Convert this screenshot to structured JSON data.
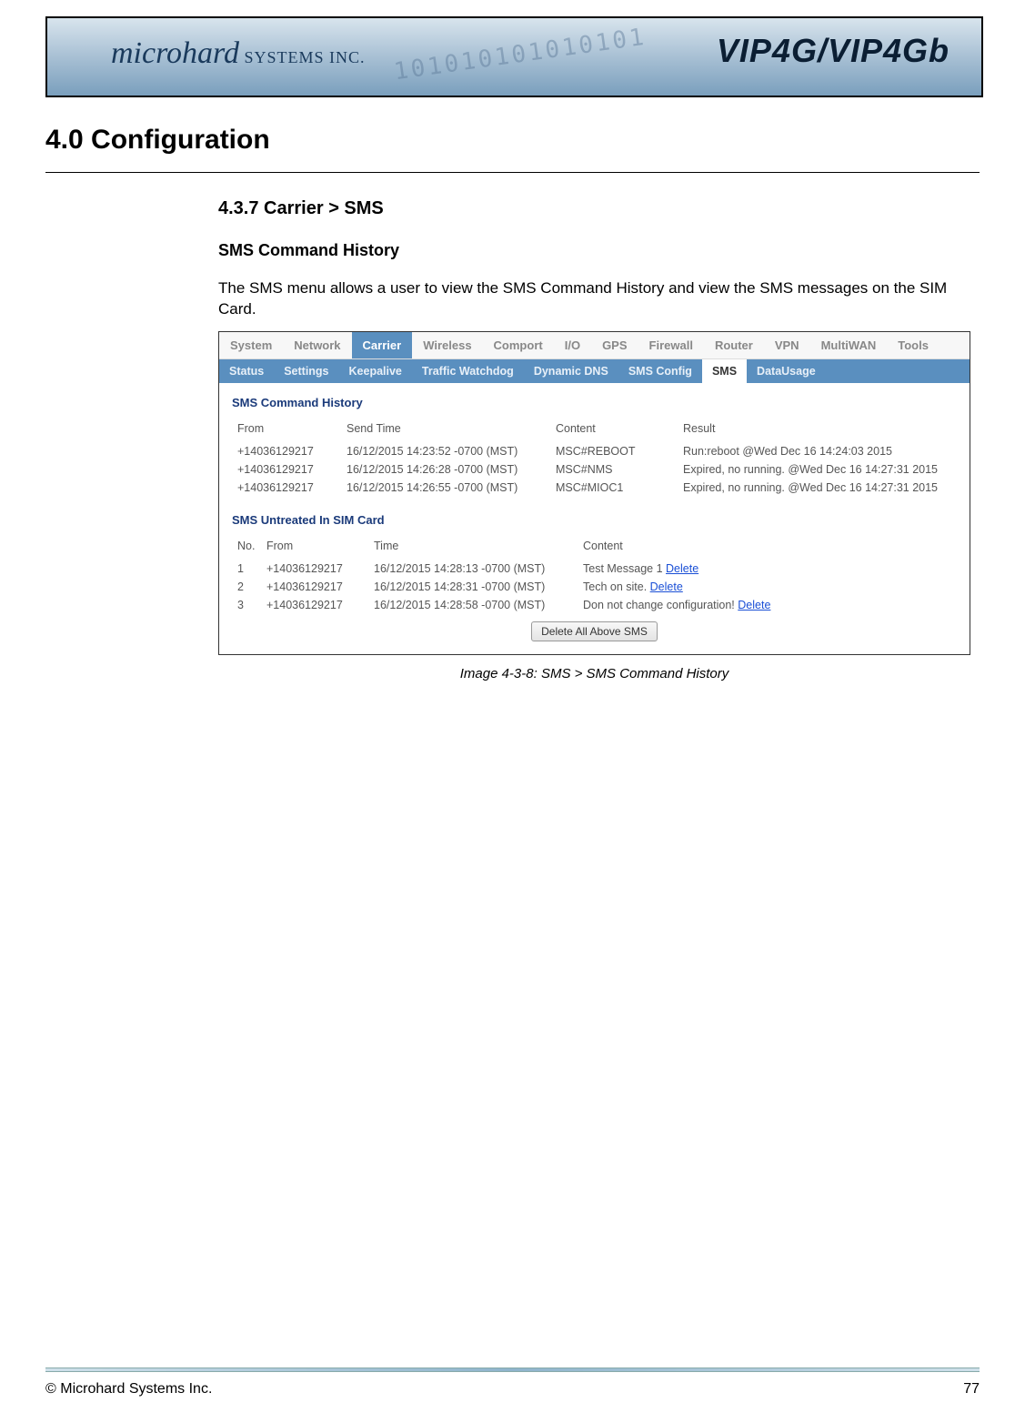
{
  "banner": {
    "company_italic": "microhard",
    "company_caps": " SYSTEMS INC.",
    "product": "VIP4G/VIP4Gb",
    "digits": "101010101010101"
  },
  "section_title": "4.0  Configuration",
  "subsection": "4.3.7 Carrier > SMS",
  "subsub": "SMS Command History",
  "body_text": "The SMS menu allows a user to view the SMS Command History and view the SMS messages on the SIM Card.",
  "toptabs": [
    "System",
    "Network",
    "Carrier",
    "Wireless",
    "Comport",
    "I/O",
    "GPS",
    "Firewall",
    "Router",
    "VPN",
    "MultiWAN",
    "Tools"
  ],
  "toptabs_active": 2,
  "subtabs": [
    "Status",
    "Settings",
    "Keepalive",
    "Traffic Watchdog",
    "Dynamic DNS",
    "SMS Config",
    "SMS",
    "DataUsage"
  ],
  "subtabs_active": 6,
  "history": {
    "title": "SMS Command History",
    "headers": [
      "From",
      "Send Time",
      "Content",
      "Result"
    ],
    "rows": [
      {
        "from": "+14036129217",
        "time": "16/12/2015 14:23:52 -0700 (MST)",
        "content": "MSC#REBOOT",
        "result": "Run:reboot @Wed Dec 16 14:24:03 2015"
      },
      {
        "from": "+14036129217",
        "time": "16/12/2015 14:26:28 -0700 (MST)",
        "content": "MSC#NMS",
        "result": "Expired, no running. @Wed Dec 16 14:27:31 2015"
      },
      {
        "from": "+14036129217",
        "time": "16/12/2015 14:26:55 -0700 (MST)",
        "content": "MSC#MIOC1",
        "result": "Expired, no running. @Wed Dec 16 14:27:31 2015"
      }
    ]
  },
  "untreated": {
    "title": "SMS Untreated In SIM Card",
    "headers": [
      "No.",
      "From",
      "Time",
      "Content"
    ],
    "rows": [
      {
        "no": "1",
        "from": "+14036129217",
        "time": "16/12/2015 14:28:13 -0700 (MST)",
        "content": "Test Message 1",
        "action": "Delete"
      },
      {
        "no": "2",
        "from": "+14036129217",
        "time": "16/12/2015 14:28:31 -0700 (MST)",
        "content": "Tech on site.",
        "action": "Delete"
      },
      {
        "no": "3",
        "from": "+14036129217",
        "time": "16/12/2015 14:28:58 -0700 (MST)",
        "content": "Don not change configuration!",
        "action": "Delete"
      }
    ],
    "button": "Delete All Above SMS"
  },
  "caption": "Image 4-3-8:  SMS  > SMS Command History",
  "footer": {
    "copyright": "© Microhard Systems Inc.",
    "page": "77"
  }
}
